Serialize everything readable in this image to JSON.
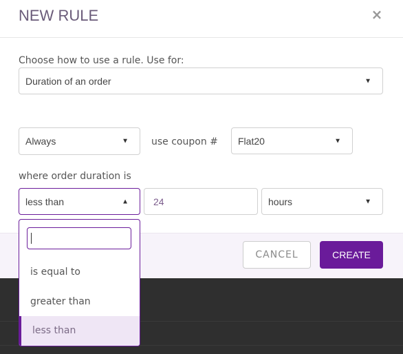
{
  "modal": {
    "title": "NEW RULE",
    "close_icon": "×"
  },
  "use_for": {
    "label": "Choose how to use a rule. Use for:",
    "selected": "Duration of an order",
    "arrow": "▼"
  },
  "condition": {
    "frequency": "Always",
    "frequency_arrow": "▼",
    "coupon_label": "use coupon #",
    "coupon": "Flat20",
    "coupon_arrow": "▼"
  },
  "duration": {
    "label": "where order duration is",
    "operator": "less than",
    "operator_arrow": "▲",
    "value": "24",
    "unit": "hours",
    "unit_arrow": "▼"
  },
  "operator_dropdown": {
    "search_value": "",
    "options": [
      {
        "label": "is equal to",
        "selected": false
      },
      {
        "label": "greater than",
        "selected": false
      },
      {
        "label": "less than",
        "selected": true
      }
    ]
  },
  "footer": {
    "cancel_label": "CANCEL",
    "create_label": "CREATE"
  },
  "colors": {
    "accent": "#6a1b9a",
    "title": "#6a5b79",
    "backdrop": "#2f2f2f"
  }
}
